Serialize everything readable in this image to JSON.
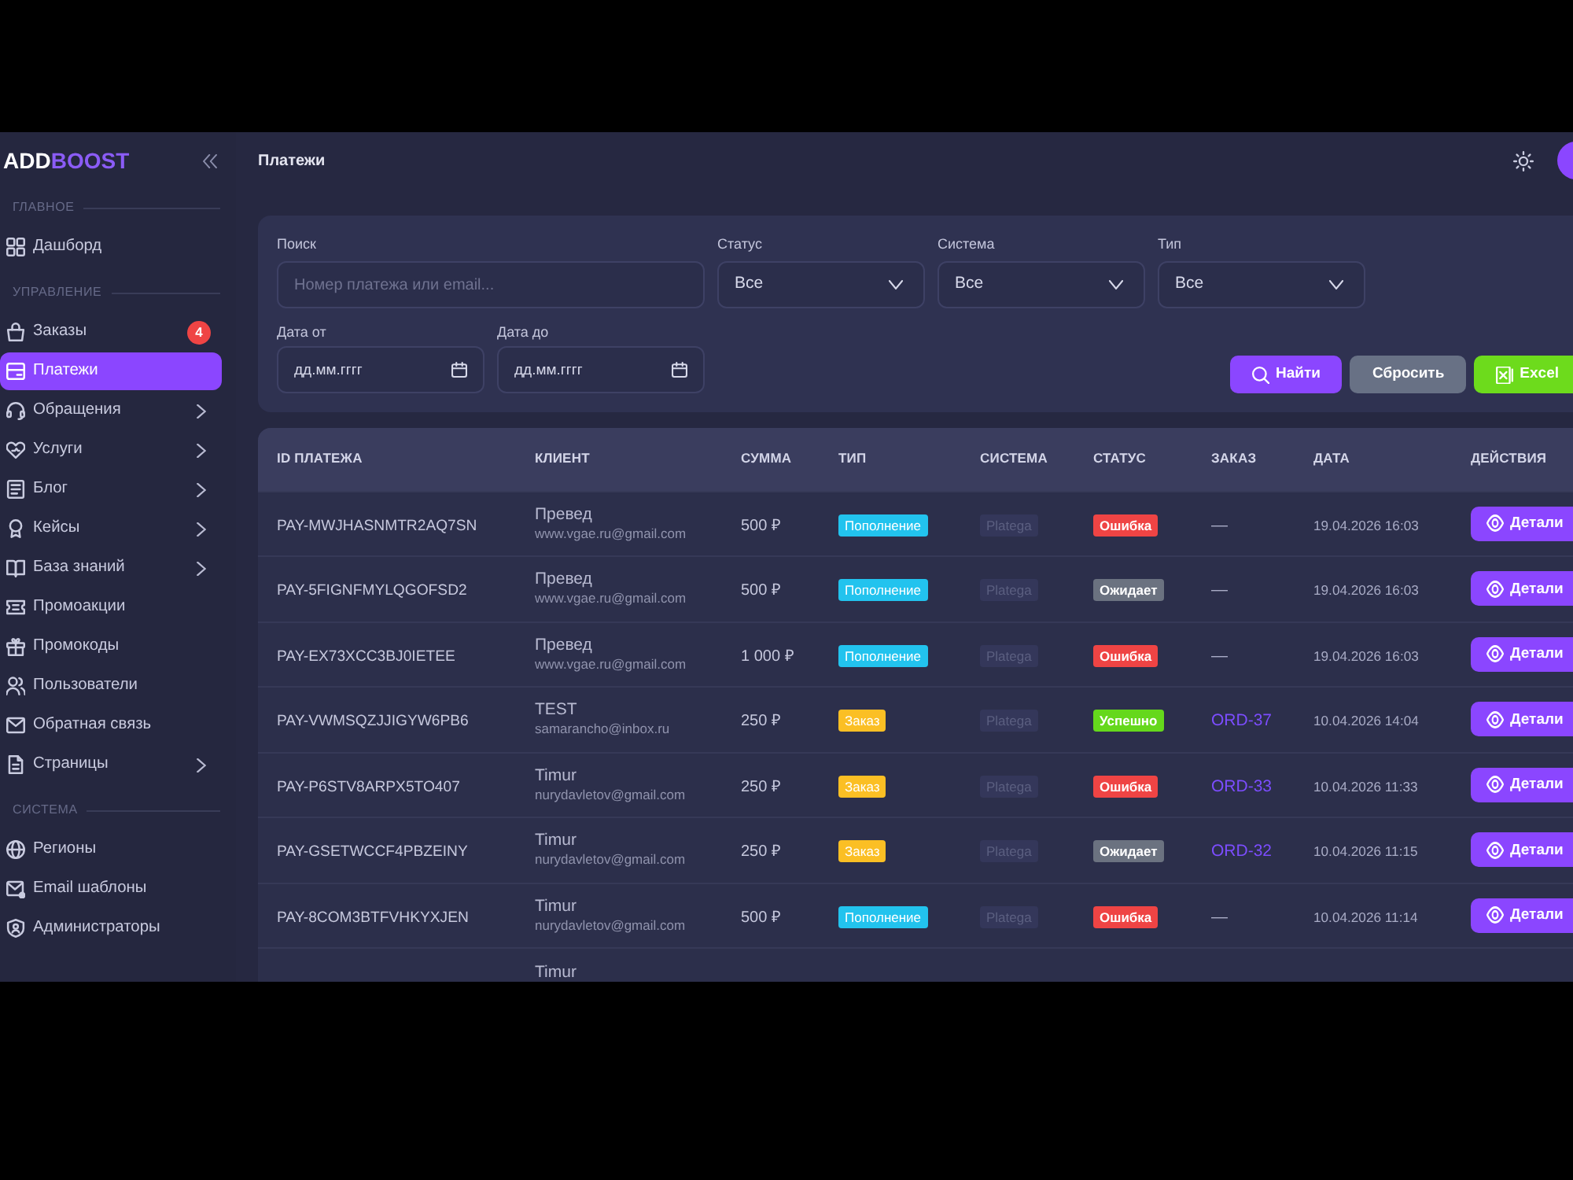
{
  "sidebar": {
    "logo": {
      "part_1": "ADD",
      "part_2": "BOOST"
    },
    "sections": [
      {
        "title": "ГЛАВНОЕ",
        "items": [
          {
            "label": "Дашборд",
            "selected": false,
            "expandable": false
          }
        ]
      },
      {
        "title": "УПРАВЛЕНИЕ",
        "items": [
          {
            "label": "Заказы",
            "selected": false,
            "expandable": false,
            "badge": "4"
          },
          {
            "label": "Платежи",
            "selected": true,
            "expandable": false
          },
          {
            "label": "Обращения",
            "selected": false,
            "expandable": true
          },
          {
            "label": "Услуги",
            "selected": false,
            "expandable": true
          },
          {
            "label": "Блог",
            "selected": false,
            "expandable": true
          },
          {
            "label": "Кейсы",
            "selected": false,
            "expandable": true
          },
          {
            "label": "База знаний",
            "selected": false,
            "expandable": true
          },
          {
            "label": "Промоакции",
            "selected": false,
            "expandable": false
          },
          {
            "label": "Промокоды",
            "selected": false,
            "expandable": false
          },
          {
            "label": "Пользователи",
            "selected": false,
            "expandable": false
          },
          {
            "label": "Обратная связь",
            "selected": false,
            "expandable": false
          },
          {
            "label": "Страницы",
            "selected": false,
            "expandable": true
          }
        ]
      },
      {
        "title": "СИСТЕМА",
        "items": [
          {
            "label": "Регионы",
            "selected": false,
            "expandable": false
          },
          {
            "label": "Email шаблоны",
            "selected": false,
            "expandable": false
          },
          {
            "label": "Администраторы",
            "selected": false,
            "expandable": false
          }
        ]
      }
    ]
  },
  "header": {
    "title": "Платежи"
  },
  "filters": {
    "rows": [
      {
        "fields": [
          {
            "kind": "text",
            "label": "Поиск",
            "placeholder": "Номер платежа или email..."
          },
          {
            "kind": "select",
            "label": "Статус",
            "value": "Все"
          },
          {
            "kind": "select",
            "label": "Система",
            "value": "Все"
          },
          {
            "kind": "select",
            "label": "Тип",
            "value": "Все"
          }
        ]
      },
      {
        "fields": [
          {
            "kind": "date",
            "label": "Дата от",
            "placeholder": "дд.мм.гггг"
          },
          {
            "kind": "date",
            "label": "Дата до",
            "placeholder": "дд.мм.гггг"
          }
        ],
        "buttons": [
          {
            "kind": "search",
            "label": "Найти"
          },
          {
            "kind": "reset",
            "label": "Сбросить"
          },
          {
            "kind": "export",
            "label": "Excel"
          }
        ]
      }
    ]
  },
  "table": {
    "columns": [
      "ID ПЛАТЕЖА",
      "КЛИЕНТ",
      "СУММА",
      "ТИП",
      "СИСТЕМА",
      "СТАТУС",
      "ЗАКАЗ",
      "ДАТА",
      "ДЕЙСТВИЯ"
    ],
    "rows": [
      {
        "id": "PAY-MWJHASNMTR2AQ7SN",
        "client_name": "Превед",
        "client_email": "www.vgae.ru@gmail.com",
        "amount": "500 ₽",
        "type": {
          "label": "Пополнение",
          "color": "#22c3ee"
        },
        "system": "Platega",
        "status": {
          "label": "Ошибка",
          "color": "#ef4444"
        },
        "order": {
          "kind": "none",
          "text": "—"
        },
        "date": "19.04.2026 16:03",
        "action": "Детали"
      },
      {
        "id": "PAY-5FIGNFMYLQGOFSD2",
        "client_name": "Превед",
        "client_email": "www.vgae.ru@gmail.com",
        "amount": "500 ₽",
        "type": {
          "label": "Пополнение",
          "color": "#22c3ee"
        },
        "system": "Platega",
        "status": {
          "label": "Ожидает",
          "color": "#6b7280"
        },
        "order": {
          "kind": "none",
          "text": "—"
        },
        "date": "19.04.2026 16:03",
        "action": "Детали"
      },
      {
        "id": "PAY-EX73XCC3BJ0IETEE",
        "client_name": "Превед",
        "client_email": "www.vgae.ru@gmail.com",
        "amount": "1 000 ₽",
        "type": {
          "label": "Пополнение",
          "color": "#22c3ee"
        },
        "system": "Platega",
        "status": {
          "label": "Ошибка",
          "color": "#ef4444"
        },
        "order": {
          "kind": "none",
          "text": "—"
        },
        "date": "19.04.2026 16:03",
        "action": "Детали"
      },
      {
        "id": "PAY-VWMSQZJJIGYW6PB6",
        "client_name": "TEST",
        "client_email": "samarancho@inbox.ru",
        "amount": "250 ₽",
        "type": {
          "label": "Заказ",
          "color": "#fbbf24"
        },
        "system": "Platega",
        "status": {
          "label": "Успешно",
          "color": "#65d81c"
        },
        "order": {
          "kind": "link",
          "text": "ORD-37"
        },
        "date": "10.04.2026 14:04",
        "action": "Детали"
      },
      {
        "id": "PAY-P6STV8ARPX5TO407",
        "client_name": "Timur",
        "client_email": "nurydavletov@gmail.com",
        "amount": "250 ₽",
        "type": {
          "label": "Заказ",
          "color": "#fbbf24"
        },
        "system": "Platega",
        "status": {
          "label": "Ошибка",
          "color": "#ef4444"
        },
        "order": {
          "kind": "link",
          "text": "ORD-33"
        },
        "date": "10.04.2026 11:33",
        "action": "Детали"
      },
      {
        "id": "PAY-GSETWCCF4PBZEINY",
        "client_name": "Timur",
        "client_email": "nurydavletov@gmail.com",
        "amount": "250 ₽",
        "type": {
          "label": "Заказ",
          "color": "#fbbf24"
        },
        "system": "Platega",
        "status": {
          "label": "Ожидает",
          "color": "#6b7280"
        },
        "order": {
          "kind": "link",
          "text": "ORD-32"
        },
        "date": "10.04.2026 11:15",
        "action": "Детали"
      },
      {
        "id": "PAY-8COM3BTFVHKYXJEN",
        "client_name": "Timur",
        "client_email": "nurydavletov@gmail.com",
        "amount": "500 ₽",
        "type": {
          "label": "Пополнение",
          "color": "#22c3ee"
        },
        "system": "Platega",
        "status": {
          "label": "Ошибка",
          "color": "#ef4444"
        },
        "order": {
          "kind": "none",
          "text": "—"
        },
        "date": "10.04.2026 11:14",
        "action": "Детали"
      },
      {
        "client_name": "Timur"
      }
    ]
  }
}
